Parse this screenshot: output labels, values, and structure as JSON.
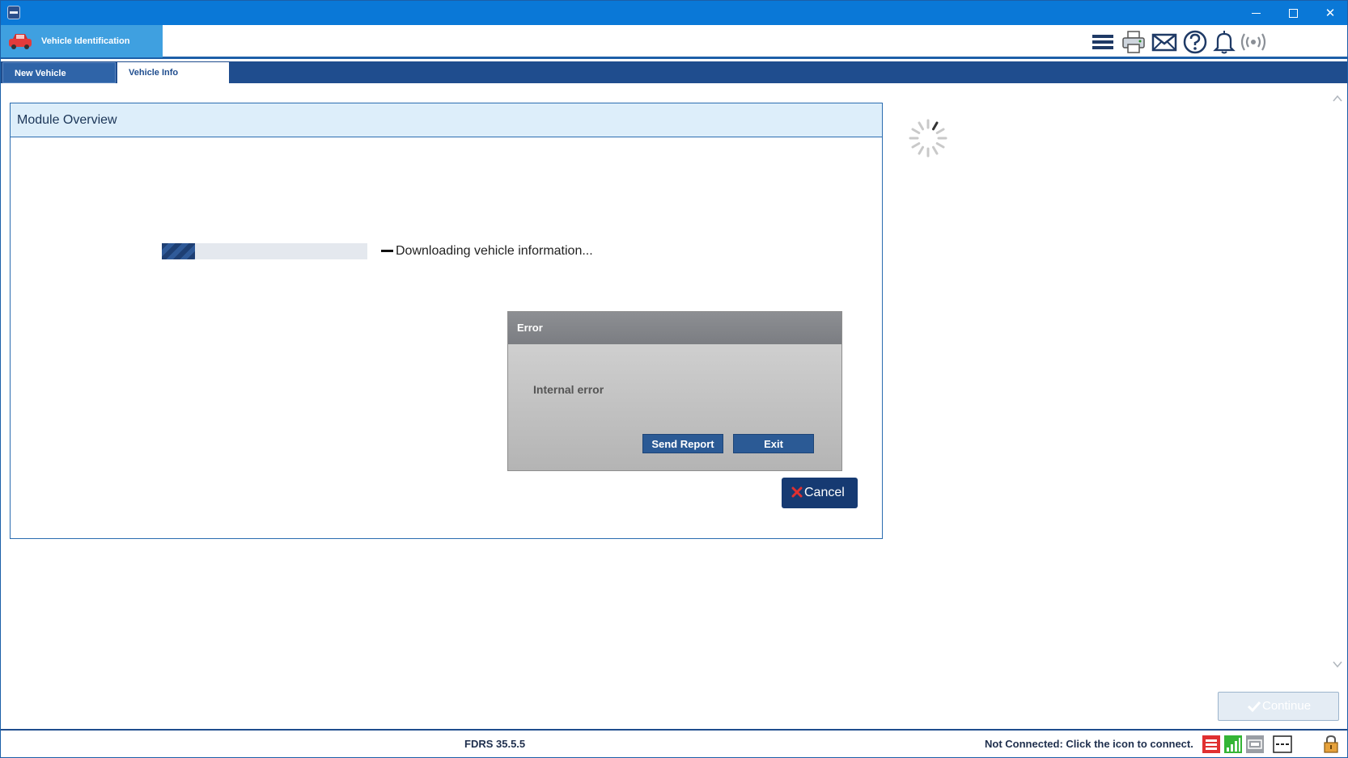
{
  "window": {
    "minimize_glyph": "",
    "maximize_glyph": "",
    "close_glyph": "✕"
  },
  "header": {
    "section_title": "Vehicle Identification",
    "toolbar_icons": [
      "menu-icon",
      "printer-icon",
      "mail-icon",
      "help-icon",
      "bell-icon",
      "broadcast-icon"
    ]
  },
  "tabs": [
    {
      "label": "New Vehicle",
      "active": false
    },
    {
      "label": "Vehicle Info",
      "active": true
    }
  ],
  "module_panel": {
    "title": "Module Overview",
    "progress": {
      "fraction": 0.16,
      "label": "Downloading vehicle information..."
    },
    "cancel_label": "Cancel"
  },
  "error_dialog": {
    "title": "Error",
    "message": "Internal error",
    "send_report_label": "Send Report",
    "exit_label": "Exit"
  },
  "continue_label": "Continue",
  "status_bar": {
    "version": "FDRS 35.5.5",
    "connection": "Not Connected: Click the icon to connect.",
    "status_icons": [
      "vci-red-icon",
      "signal-bars-icon",
      "vci-device-icon",
      "dash-indicator-icon",
      "padlock-icon"
    ]
  },
  "colors": {
    "title_bar": "#0a78d7",
    "accent_blue": "#1f4d8e",
    "header_tab": "#3fa0e0",
    "cancel_red": "#e03030",
    "signal_green": "#35b536"
  }
}
